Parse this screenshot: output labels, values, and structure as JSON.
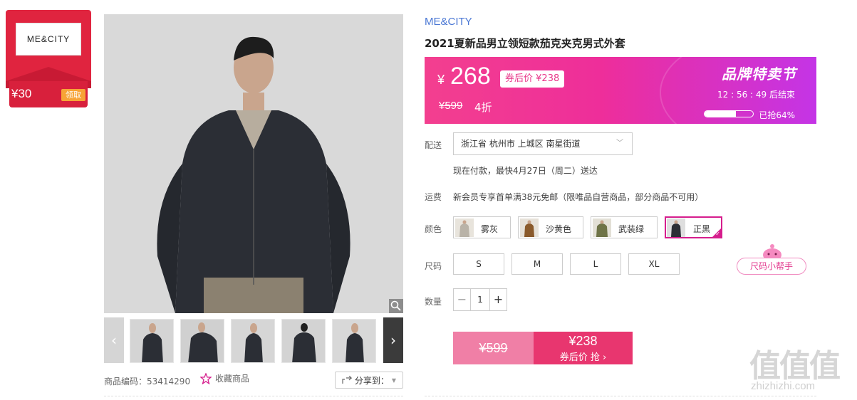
{
  "store": {
    "logo_text": "ME&CITY",
    "coupon_amount": "¥30",
    "coupon_claim": "领取"
  },
  "gallery": {
    "sku_label": "商品编码：53414290",
    "favorite_label": "收藏商品",
    "share_label": "分享到："
  },
  "product": {
    "brand": "ME&CITY",
    "title": "2021夏新品男立领短款茄克夹克男式外套"
  },
  "promo": {
    "currency": "¥",
    "price_now": "268",
    "after_coupon_label": "券后价",
    "after_coupon_price": "¥238",
    "price_original": "¥599",
    "discount": "4折",
    "festival": "品牌特卖节",
    "countdown": "12 : 56 : 49  后结束",
    "sold_percent": 64,
    "sold_text": "已抢64%"
  },
  "delivery": {
    "label": "配送",
    "address": "浙江省 杭州市 上城区 南星街道",
    "eta": "现在付款，最快4月27日（周二）送达"
  },
  "shipping": {
    "label": "运费",
    "text": "新会员专享首单满38元免邮（限唯品自营商品，部分商品不可用）"
  },
  "colors": {
    "label": "颜色",
    "options": [
      {
        "name": "雾灰",
        "selected": false,
        "swatch": "#b9b3a8"
      },
      {
        "name": "沙黄色",
        "selected": false,
        "swatch": "#8a5a2b"
      },
      {
        "name": "武装绿",
        "selected": false,
        "swatch": "#6f7448"
      },
      {
        "name": "正黑",
        "selected": true,
        "swatch": "#2c2f36"
      }
    ]
  },
  "sizes": {
    "label": "尺码",
    "options": [
      "S",
      "M",
      "L",
      "XL"
    ],
    "helper": "尺码小帮手"
  },
  "quantity": {
    "label": "数量",
    "value": "1",
    "minus": "−",
    "plus": "+"
  },
  "buy": {
    "original": "¥599",
    "coupon_price": "¥238",
    "coupon_label": "券后价 抢"
  },
  "watermark": {
    "site": "zhizhizhi.com"
  },
  "theme": {
    "accent": "#d61d8d",
    "brand_blue": "#4a77d4",
    "store_red": "#e0243f"
  }
}
